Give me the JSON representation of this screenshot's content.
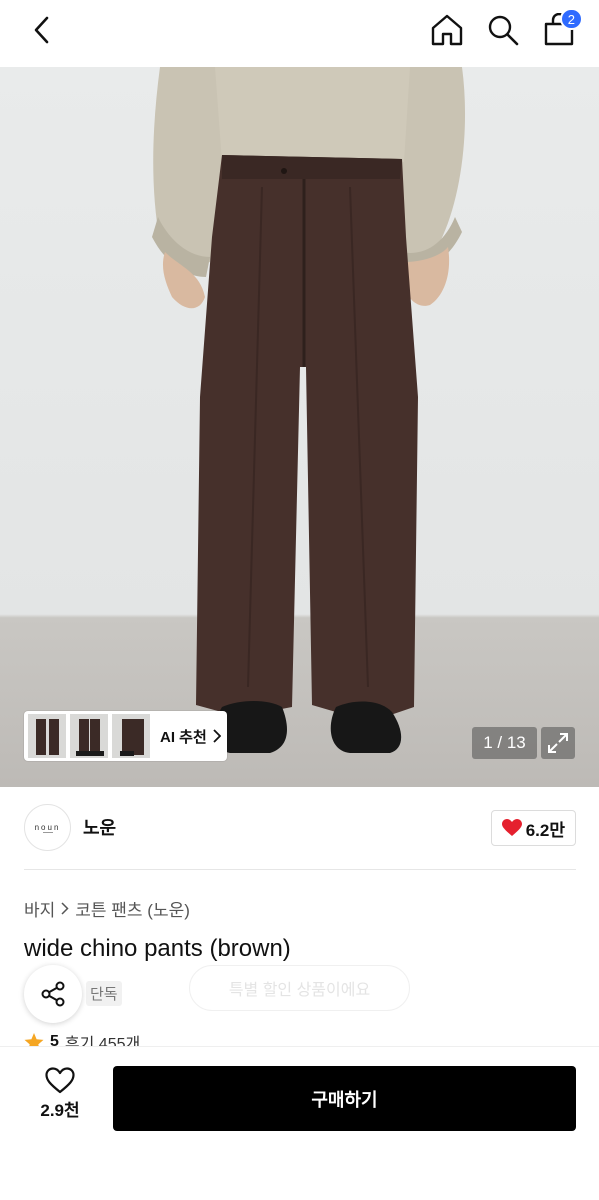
{
  "header": {
    "cart_count": "2",
    "icons": [
      "back-icon",
      "home-icon",
      "search-icon",
      "cart-icon"
    ]
  },
  "gallery": {
    "ai_recommend_label": "AI 추천",
    "counter": "1 / 13",
    "thumbnail_count": 3
  },
  "brand": {
    "logo_text": "noun",
    "name": "노운",
    "likes": "6.2만"
  },
  "product": {
    "breadcrumb": [
      "바지",
      "코튼 팬츠 (노운)"
    ],
    "title": "wide chino pants (brown)",
    "tag": "단독",
    "pill_text": "특별 할인 상품이에요",
    "rating": "5",
    "reviews": "후기 455개"
  },
  "bottom_bar": {
    "wish_count": "2.9천",
    "buy_label": "구매하기"
  },
  "colors": {
    "accent_blue": "#2f6bff",
    "heart_red": "#e5202e",
    "star_orange": "#f5a623",
    "buy_button": "#000000"
  }
}
